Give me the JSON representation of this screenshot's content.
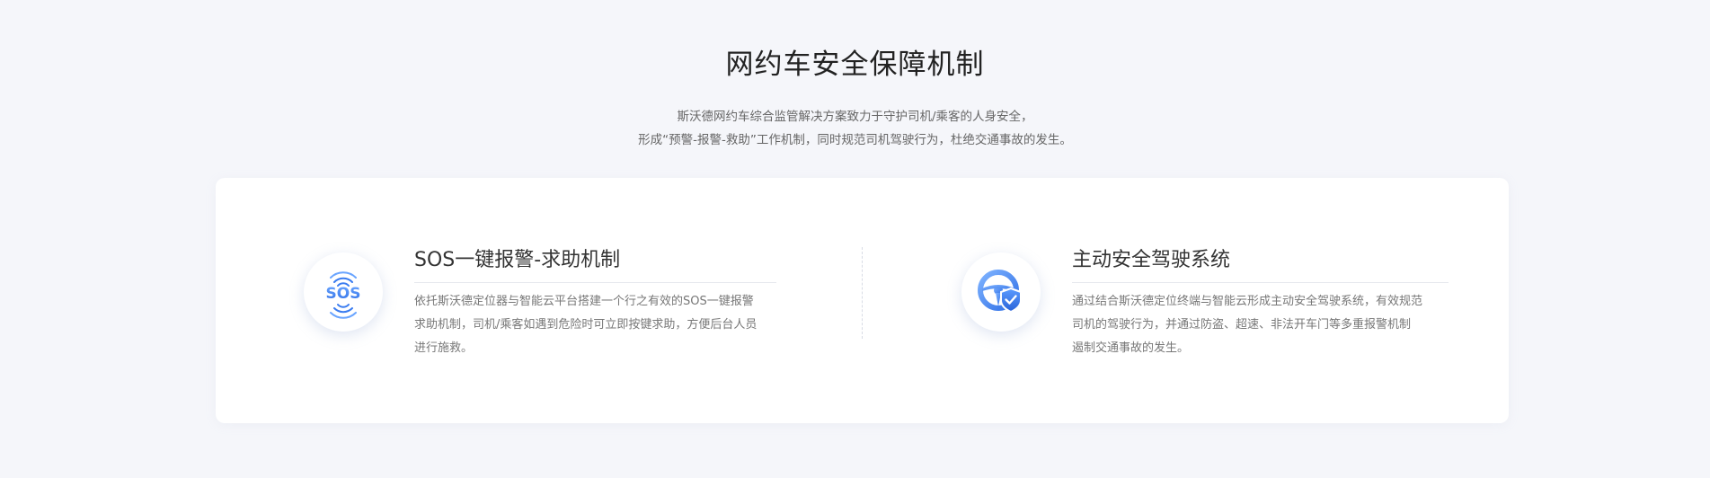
{
  "section": {
    "title": "网约车安全保障机制",
    "subtitle_lines": [
      "斯沃德网约车综合监管解决方案致力于守护司机/乘客的人身安全，",
      "形成“预警-报警-救助”工作机制，同时规范司机驾驶行为，杜绝交通事故的发生。"
    ]
  },
  "features": [
    {
      "icon": "sos-signal-icon",
      "icon_label": "SOS",
      "title": "SOS一键报警-求助机制",
      "desc_lines": [
        "依托斯沃德定位器与智能云平台搭建一个行之有效的SOS一键报警",
        "求助机制，司机/乘客如遇到危险时可立即按键求助，方便后台人员",
        "进行施救。"
      ]
    },
    {
      "icon": "steering-wheel-shield-icon",
      "title": "主动安全驾驶系统",
      "desc_lines": [
        "通过结合斯沃德定位终端与智能云形成主动安全驾驶系统，有效规范",
        "司机的驾驶行为，并通过防盗、超速、非法开车门等多重报警机制",
        "遏制交通事故的发生。"
      ]
    }
  ],
  "colors": {
    "accent": "#3a7cf0",
    "accent_light": "#6aa5ff",
    "background": "#f5f6fa",
    "card": "#ffffff"
  }
}
